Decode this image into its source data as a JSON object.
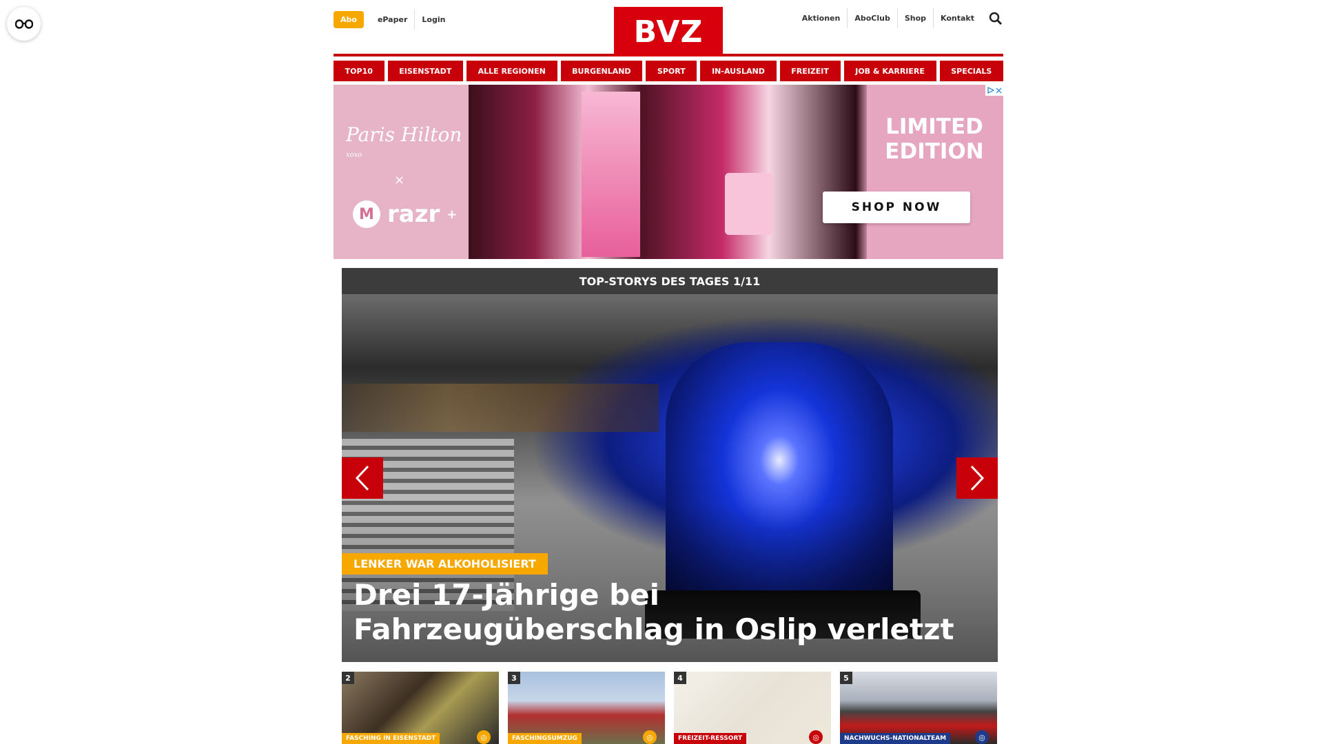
{
  "topbar": {
    "abo": "Abo",
    "left_links": [
      "ePaper",
      "Login"
    ],
    "logo": "BVZ",
    "right_links": [
      "Aktionen",
      "AboClub",
      "Shop",
      "Kontakt"
    ]
  },
  "nav": [
    "TOP10",
    "EISENSTADT",
    "ALLE REGIONEN",
    "BURGENLAND",
    "SPORT",
    "IN-AUSLAND",
    "FREIZEIT",
    "JOB & KARRIERE",
    "SPECIALS"
  ],
  "ad": {
    "brand": "Paris Hilton",
    "brand_suffix": "xoxo",
    "times": "×",
    "partner": "razr",
    "partner_plus": "+",
    "partner_logo_letter": "M",
    "limited": "LIMITED EDITION",
    "cta": "SHOP NOW"
  },
  "slider": {
    "heading": "TOP-STORYS DES TAGES 1/11",
    "kicker": "LENKER WAR ALKOHOLISIERT",
    "headline": "Drei 17-Jährige bei Fahrzeugüberschlag in Oslip verletzt"
  },
  "thumbs": [
    {
      "num": "2",
      "tag": "FASCHING IN EISENSTADT",
      "tag_color": "orange",
      "icon_color": "#f6a800"
    },
    {
      "num": "3",
      "tag": "FASCHINGSUMZUG",
      "tag_color": "orange",
      "icon_color": "#f6a800"
    },
    {
      "num": "4",
      "tag": "FREIZEIT-RESSORT",
      "tag_color": "red",
      "icon_color": "#c8000a"
    },
    {
      "num": "5",
      "tag": "NACHWUCHS-NATIONALTEAM",
      "tag_color": "blue",
      "icon_color": "#1e3a8a"
    }
  ],
  "colors": {
    "brand_red": "#c8000a",
    "accent_orange": "#f6a800",
    "dark_header": "#3c3c3c"
  }
}
